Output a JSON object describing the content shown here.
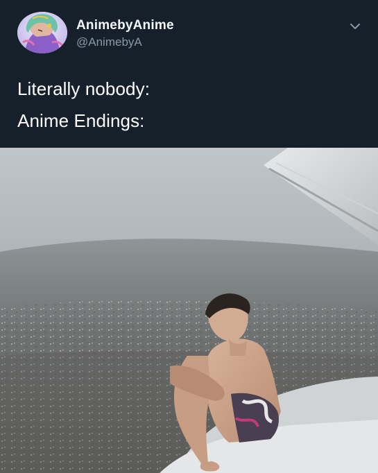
{
  "tweet": {
    "display_name": "AnimebyAnime",
    "handle": "@AnimebyA",
    "avatar_icon": "anime-character-avatar",
    "menu_icon": "chevron-down-icon",
    "lines": [
      "Literally nobody:",
      "Anime Endings:"
    ]
  },
  "colors": {
    "background": "#15202b",
    "name_text": "#f5f8fa",
    "handle_text": "#8899a6",
    "body_text": "#ffffff"
  }
}
